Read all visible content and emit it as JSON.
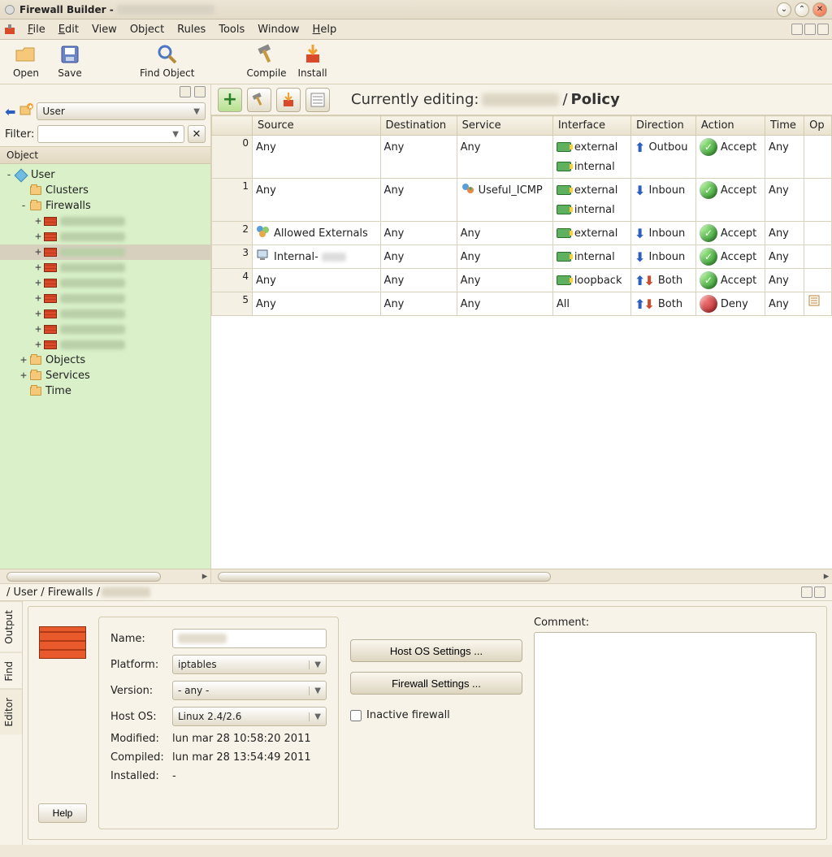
{
  "window": {
    "title": "Firewall Builder -",
    "title_blurred_object": "(redacted)"
  },
  "menubar": [
    "File",
    "Edit",
    "View",
    "Object",
    "Rules",
    "Tools",
    "Window",
    "Help"
  ],
  "menu_underline_idx": [
    0,
    0,
    -1,
    -1,
    -1,
    -1,
    -1,
    0
  ],
  "toolbar": [
    {
      "id": "open",
      "label": "Open"
    },
    {
      "id": "save",
      "label": "Save"
    },
    {
      "id": "find",
      "label": "Find Object"
    },
    {
      "id": "compile",
      "label": "Compile"
    },
    {
      "id": "install",
      "label": "Install"
    }
  ],
  "sidebar": {
    "library_dropdown": "User",
    "filter_label": "Filter:",
    "object_header": "Object",
    "tree": [
      {
        "depth": 0,
        "exp": "-",
        "icon": "lib",
        "label": "User"
      },
      {
        "depth": 1,
        "exp": "",
        "icon": "folder",
        "label": "Clusters"
      },
      {
        "depth": 1,
        "exp": "-",
        "icon": "folder",
        "label": "Firewalls"
      },
      {
        "depth": 2,
        "exp": "+",
        "icon": "fw",
        "label": "(redacted)",
        "blurred": true
      },
      {
        "depth": 2,
        "exp": "+",
        "icon": "fw",
        "label": "(redacted)",
        "blurred": true
      },
      {
        "depth": 2,
        "exp": "+",
        "icon": "fw",
        "label": "(redacted)",
        "blurred": true,
        "selected": true
      },
      {
        "depth": 2,
        "exp": "+",
        "icon": "fw",
        "label": "(redacted)",
        "blurred": true
      },
      {
        "depth": 2,
        "exp": "+",
        "icon": "fw",
        "label": "(redacted)",
        "blurred": true
      },
      {
        "depth": 2,
        "exp": "+",
        "icon": "fw",
        "label": "(redacted)",
        "blurred": true
      },
      {
        "depth": 2,
        "exp": "+",
        "icon": "fw",
        "label": "(redacted)",
        "blurred": true
      },
      {
        "depth": 2,
        "exp": "+",
        "icon": "fw",
        "label": "(redacted)",
        "blurred": true
      },
      {
        "depth": 2,
        "exp": "+",
        "icon": "fw",
        "label": "(redacted)",
        "blurred": true
      },
      {
        "depth": 1,
        "exp": "+",
        "icon": "folder",
        "label": "Objects"
      },
      {
        "depth": 1,
        "exp": "+",
        "icon": "folder",
        "label": "Services"
      },
      {
        "depth": 1,
        "exp": "",
        "icon": "folder",
        "label": "Time"
      }
    ]
  },
  "rules": {
    "toolbar_title_prefix": "Currently editing:",
    "toolbar_title_suffix": "/",
    "toolbar_title_policy": "Policy",
    "columns": [
      "",
      "Source",
      "Destination",
      "Service",
      "Interface",
      "Direction",
      "Action",
      "Time",
      "Op"
    ],
    "rows": [
      {
        "num": "0",
        "source": "Any",
        "destination": "Any",
        "service": "Any",
        "interfaces": [
          {
            "icon": "if",
            "text": "external"
          },
          {
            "icon": "if",
            "text": "internal"
          }
        ],
        "direction": {
          "icon": "up",
          "text": "Outbou"
        },
        "action": {
          "type": "accept",
          "text": "Accept"
        },
        "time": "Any"
      },
      {
        "num": "1",
        "source": "Any",
        "destination": "Any",
        "service": "Useful_ICMP",
        "service_icon": "svc",
        "interfaces": [
          {
            "icon": "if",
            "text": "external"
          },
          {
            "icon": "if",
            "text": "internal"
          }
        ],
        "direction": {
          "icon": "down",
          "text": "Inboun"
        },
        "action": {
          "type": "accept",
          "text": "Accept"
        },
        "time": "Any"
      },
      {
        "num": "2",
        "source": "Allowed Externals",
        "source_icon": "grp",
        "destination": "Any",
        "service": "Any",
        "interfaces": [
          {
            "icon": "if",
            "text": "external"
          }
        ],
        "direction": {
          "icon": "down",
          "text": "Inboun"
        },
        "action": {
          "type": "accept",
          "text": "Accept"
        },
        "time": "Any"
      },
      {
        "num": "3",
        "source": "Internal-",
        "source_icon": "host",
        "source_blur": true,
        "destination": "Any",
        "service": "Any",
        "interfaces": [
          {
            "icon": "if",
            "text": "internal"
          }
        ],
        "direction": {
          "icon": "down",
          "text": "Inboun"
        },
        "action": {
          "type": "accept",
          "text": "Accept"
        },
        "time": "Any"
      },
      {
        "num": "4",
        "source": "Any",
        "destination": "Any",
        "service": "Any",
        "interfaces": [
          {
            "icon": "if",
            "text": "loopback"
          }
        ],
        "direction": {
          "icon": "both",
          "text": "Both"
        },
        "action": {
          "type": "accept",
          "text": "Accept"
        },
        "time": "Any"
      },
      {
        "num": "5",
        "source": "Any",
        "destination": "Any",
        "service": "Any",
        "interfaces": [
          {
            "text": "All"
          }
        ],
        "direction": {
          "icon": "both",
          "text": "Both"
        },
        "action": {
          "type": "deny",
          "text": "Deny"
        },
        "time": "Any",
        "op_icon": true
      }
    ]
  },
  "breadcrumb": "/ User / Firewalls / ",
  "editor": {
    "tabs": [
      "Output",
      "Find",
      "Editor"
    ],
    "active_tab": 2,
    "form": {
      "name_label": "Name:",
      "platform_label": "Platform:",
      "platform": "iptables",
      "version_label": "Version:",
      "version": "- any -",
      "hostos_label": "Host OS:",
      "hostos": "Linux 2.4/2.6",
      "modified_label": "Modified:",
      "modified": "lun mar 28 10:58:20 2011",
      "compiled_label": "Compiled:",
      "compiled": "lun mar 28 13:54:49 2011",
      "installed_label": "Installed:",
      "installed": "-"
    },
    "host_os_btn": "Host OS Settings ...",
    "fw_settings_btn": "Firewall Settings ...",
    "inactive_label": "Inactive firewall",
    "comment_label": "Comment:",
    "help_label": "Help"
  }
}
